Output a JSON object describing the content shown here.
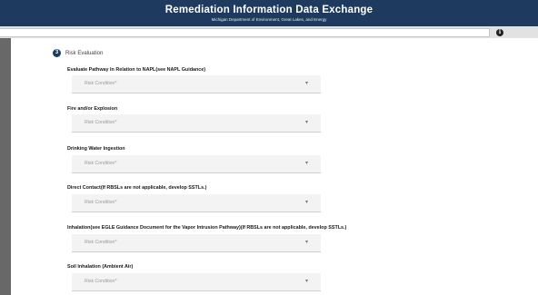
{
  "header": {
    "title": "Remediation Information Data Exchange",
    "subtitle": "Michigan Department of Environment, Great Lakes, and Energy"
  },
  "toolbar": {
    "info_icon": "i"
  },
  "step": {
    "number": "3",
    "label": "Risk Evaluation"
  },
  "sections": [
    {
      "title": "Evaluate Pathway In Relation to NAPL(see NAPL Guidance)",
      "placeholder": "Risk Condition*"
    },
    {
      "title": "Fire and/or Explosion",
      "placeholder": "Risk Condition*"
    },
    {
      "title": "Drinking Water Ingestion",
      "placeholder": "Risk Condition*"
    },
    {
      "title": "Direct Contact(If RBSLs are not applicable, develop SSTLs.)",
      "placeholder": "Risk Condition*"
    },
    {
      "title": "Inhalation(see EGLE Guidance Document for the Vapor Intrusion Pathway)(If RBSLs are not applicable, develop SSTLs.)",
      "placeholder": "Risk Condition*"
    },
    {
      "title": "Soil Inhalation (Ambient Air)",
      "placeholder": "Risk Condition*"
    }
  ],
  "caret_icon": "▾"
}
